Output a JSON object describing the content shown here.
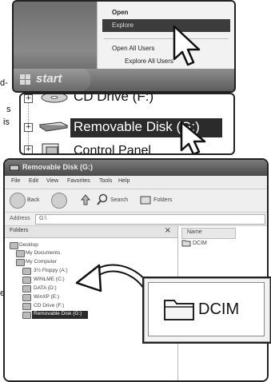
{
  "side_text": {
    "line_a": "d-",
    "line_b": "s",
    "line_c": "is",
    "line_d": "e"
  },
  "context_menu": {
    "items": [
      "Open",
      "Explore",
      "Open All Users",
      "Explore All Users"
    ],
    "highlighted": "Explore"
  },
  "taskbar": {
    "start_label": "start"
  },
  "tree_zoom": {
    "top_item": "CD Drive (F:)",
    "selected_item": "Removable Disk (G:)",
    "bottom_item": "Control Panel"
  },
  "explorer": {
    "title": "Removable Disk (G:)",
    "menu": [
      "File",
      "Edit",
      "View",
      "Favorites",
      "Tools",
      "Help"
    ],
    "toolbar": {
      "back": "Back",
      "search": "Search",
      "folders": "Folders"
    },
    "address_label": "Address",
    "address_value": "G:\\",
    "folders_header": "Folders",
    "close_x": "×",
    "tree": [
      {
        "label": "Desktop"
      },
      {
        "label": "My Documents"
      },
      {
        "label": "My Computer"
      },
      {
        "label": "3½ Floppy (A:)"
      },
      {
        "label": "WINLME (C:)"
      },
      {
        "label": "DATA (D:)"
      },
      {
        "label": "WinXP (E:)"
      },
      {
        "label": "CD Drive (F:)"
      },
      {
        "label": "Removable Disk (G:)"
      }
    ],
    "column_header": "Name",
    "file_item": "DCIM"
  },
  "callout": {
    "label": "DCIM"
  }
}
